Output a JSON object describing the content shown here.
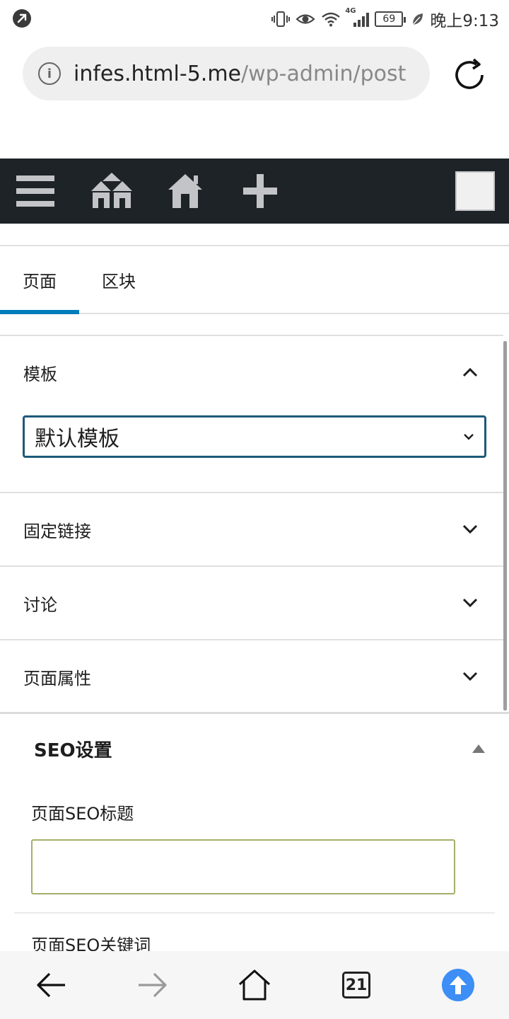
{
  "status_bar": {
    "time": "晚上9:13",
    "battery": "69",
    "network": "4G",
    "icons": [
      "vibrate-icon",
      "eye-icon",
      "wifi-icon",
      "signal-icon",
      "battery-icon",
      "leaf-icon"
    ]
  },
  "browser": {
    "url_host": "infes.html-5.me",
    "url_path": "/wp-admin/post-ne"
  },
  "admin_bar": {
    "icons": [
      "menu-icon",
      "sites-icon",
      "home-icon",
      "plus-icon",
      "avatar"
    ]
  },
  "sidebar_tabs": [
    {
      "label": "页面",
      "active": true
    },
    {
      "label": "区块",
      "active": false
    }
  ],
  "panels": {
    "template": {
      "title": "模板",
      "selected": "默认模板",
      "expanded": true
    },
    "permalink": {
      "title": "固定链接",
      "expanded": false
    },
    "discussion": {
      "title": "讨论",
      "expanded": false
    },
    "page_attributes": {
      "title": "页面属性",
      "expanded": false
    }
  },
  "seo": {
    "title": "SEO设置",
    "page_title_label": "页面SEO标题",
    "page_title_value": "",
    "keywords_label": "页面SEO关键词"
  },
  "bottom_nav": {
    "tab_count": "21",
    "accent_color": "#3d8ef5"
  },
  "colors": {
    "admin_bar": "#1d2327",
    "active_tab": "#007cba",
    "select_border": "#1d5a7a"
  }
}
